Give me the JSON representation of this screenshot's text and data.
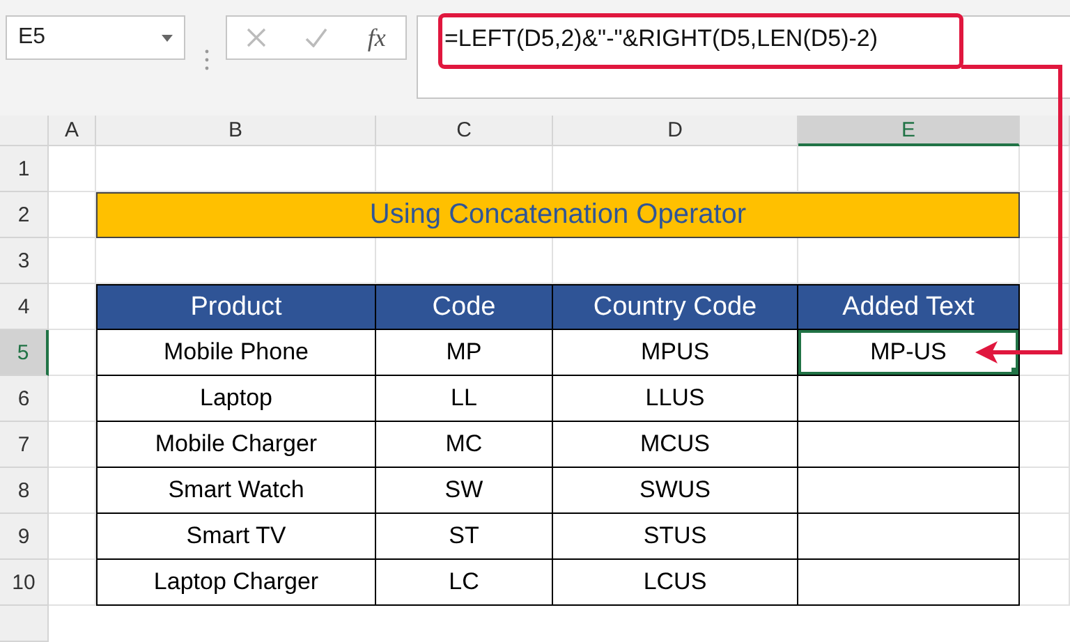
{
  "name_box": {
    "value": "E5"
  },
  "function_label": "fx",
  "formula_bar": {
    "value": "=LEFT(D5,2)&\"-\"&RIGHT(D5,LEN(D5)-2)"
  },
  "columns": [
    {
      "label": "A",
      "selected": false
    },
    {
      "label": "B",
      "selected": false
    },
    {
      "label": "C",
      "selected": false
    },
    {
      "label": "D",
      "selected": false
    },
    {
      "label": "E",
      "selected": true
    }
  ],
  "rows": [
    {
      "label": "1",
      "selected": false
    },
    {
      "label": "2",
      "selected": false
    },
    {
      "label": "3",
      "selected": false
    },
    {
      "label": "4",
      "selected": false
    },
    {
      "label": "5",
      "selected": true
    },
    {
      "label": "6",
      "selected": false
    },
    {
      "label": "7",
      "selected": false
    },
    {
      "label": "8",
      "selected": false
    },
    {
      "label": "9",
      "selected": false
    },
    {
      "label": "10",
      "selected": false
    }
  ],
  "title": "Using Concatenation Operator",
  "table": {
    "columns": [
      "Product",
      "Code",
      "Country Code",
      "Added Text"
    ],
    "rows": [
      {
        "cells": [
          {
            "text": "Mobile Phone",
            "selected": false
          },
          {
            "text": "MP",
            "selected": false
          },
          {
            "text": "MPUS",
            "selected": false
          },
          {
            "text": "MP-US",
            "selected": true
          }
        ]
      },
      {
        "cells": [
          {
            "text": "Laptop",
            "selected": false
          },
          {
            "text": "LL",
            "selected": false
          },
          {
            "text": "LLUS",
            "selected": false
          },
          {
            "selected": false
          }
        ]
      },
      {
        "cells": [
          {
            "text": "Mobile Charger",
            "selected": false
          },
          {
            "text": "MC",
            "selected": false
          },
          {
            "text": "MCUS",
            "selected": false
          },
          {
            "selected": false
          }
        ]
      },
      {
        "cells": [
          {
            "text": "Smart Watch",
            "selected": false
          },
          {
            "text": "SW",
            "selected": false
          },
          {
            "text": "SWUS",
            "selected": false
          },
          {
            "selected": false
          }
        ]
      },
      {
        "cells": [
          {
            "text": "Smart TV",
            "selected": false
          },
          {
            "text": "ST",
            "selected": false
          },
          {
            "text": "STUS",
            "selected": false
          },
          {
            "selected": false
          }
        ]
      },
      {
        "cells": [
          {
            "text": "Laptop Charger",
            "selected": false
          },
          {
            "text": "LC",
            "selected": false
          },
          {
            "text": "LCUS",
            "selected": false
          },
          {
            "selected": false
          }
        ]
      }
    ]
  }
}
